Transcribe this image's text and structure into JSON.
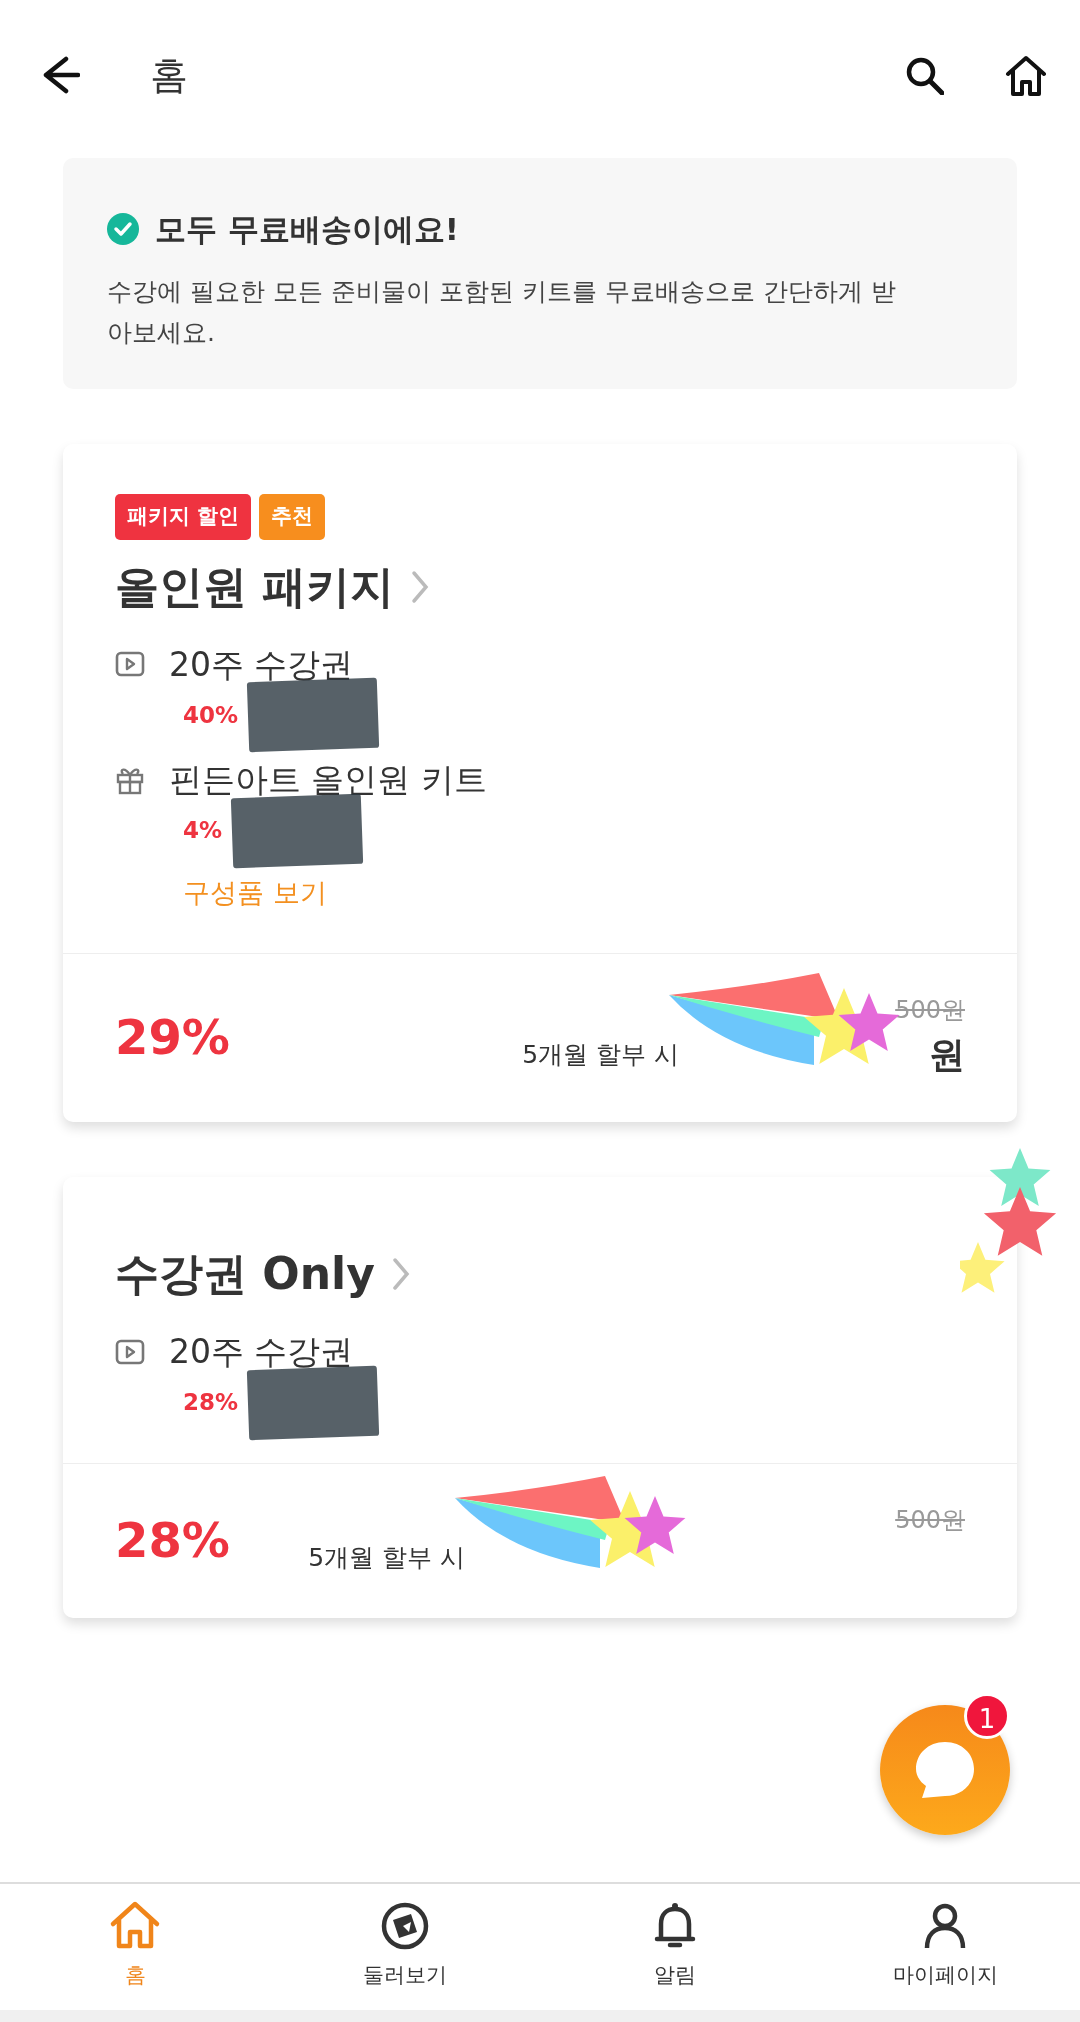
{
  "header": {
    "title": "홈"
  },
  "notice": {
    "title": "모두 무료배송이에요!",
    "text": "수강에 필요한 모든 준비물이 포함된 키트를 무료배송으로 간단하게 받아보세요."
  },
  "packages": [
    {
      "badges": [
        {
          "label": "패키지 할인",
          "color": "#ef3340"
        },
        {
          "label": "추천",
          "color": "#f78e1e"
        }
      ],
      "title": "올인원 패키지",
      "items": [
        {
          "kind": "video",
          "name": "20주 수강권",
          "discount": "40%",
          "redacted": true
        },
        {
          "kind": "gift",
          "name": "핀든아트 올인원 키트",
          "discount": "4%",
          "redacted": true
        }
      ],
      "link": "구성품 보기",
      "discount": "29%",
      "original_price": "500원",
      "installment": "5개월 할부 시",
      "monthly_price": "원"
    },
    {
      "title": "수강권 Only",
      "items": [
        {
          "kind": "video",
          "name": "20주 수강권",
          "discount": "28%",
          "redacted": true
        }
      ],
      "discount": "28%",
      "original_price": "500원",
      "installment": "5개월 할부 시"
    }
  ],
  "chat_button": {
    "badge": "1"
  },
  "bottom_nav": [
    {
      "kind": "home",
      "label": "홈",
      "selected": true
    },
    {
      "kind": "explore",
      "label": "둘러보기",
      "selected": false
    },
    {
      "kind": "bell",
      "label": "알림",
      "selected": false
    },
    {
      "kind": "person",
      "label": "마이페이지",
      "selected": false
    }
  ]
}
